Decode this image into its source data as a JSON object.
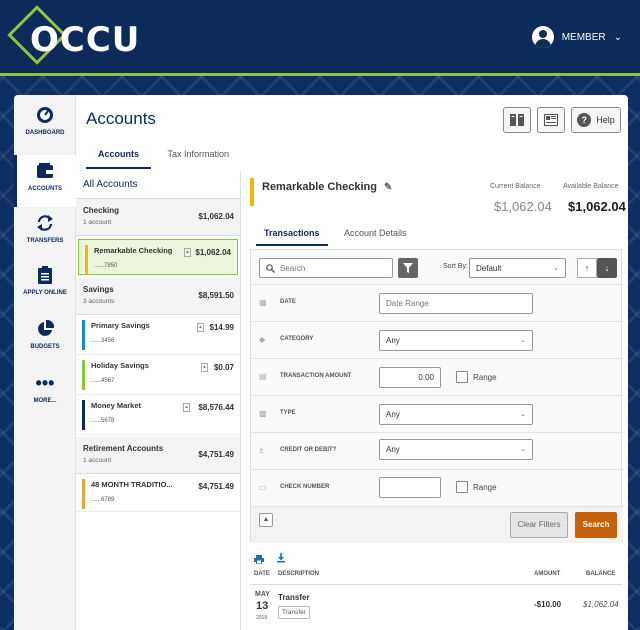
{
  "brand": {
    "logo_text": "OCCU",
    "accent": "#8cc63f",
    "navy": "#0c2a5a"
  },
  "header": {
    "member_label": "MEMBER"
  },
  "sidenav": [
    {
      "label": "DASHBOARD",
      "icon": "dashboard-icon"
    },
    {
      "label": "ACCOUNTS",
      "icon": "wallet-icon"
    },
    {
      "label": "TRANSFERS",
      "icon": "transfer-arrows-icon"
    },
    {
      "label": "APPLY ONLINE",
      "icon": "clipboard-icon"
    },
    {
      "label": "BUDGETS",
      "icon": "pie-chart-icon"
    },
    {
      "label": "MORE...",
      "icon": "more-icon"
    }
  ],
  "page": {
    "title": "Accounts",
    "help_label": "Help",
    "tabs": [
      "Accounts",
      "Tax Information"
    ]
  },
  "accounts": {
    "all_label": "All Accounts",
    "groups": [
      {
        "name": "Checking",
        "count": "1 account",
        "total": "$1,062.04",
        "items": [
          {
            "name": "Remarkable Checking",
            "number": "......7850",
            "amount": "$1,062.04",
            "color": "#f5b800"
          }
        ]
      },
      {
        "name": "Savings",
        "count": "3 accounts",
        "total": "$8,591.50",
        "items": [
          {
            "name": "Primary Savings",
            "number": "......3456",
            "amount": "$14.99",
            "color": "#1e88c8"
          },
          {
            "name": "Holiday Savings",
            "number": "......4567",
            "amount": "$0.07",
            "color": "#8cc63f"
          },
          {
            "name": "Money Market",
            "number": "......5678",
            "amount": "$8,576.44",
            "color": "#0c2a5a"
          }
        ]
      },
      {
        "name": "Retirement Accounts",
        "count": "1 account",
        "total": "$4,751.49",
        "items": [
          {
            "name": "48 MONTH TRADITIO...",
            "number": "......6789",
            "amount": "$4,751.49",
            "color": "#e8a33c"
          }
        ]
      }
    ]
  },
  "detail": {
    "title": "Remarkable Checking",
    "current_balance_label": "Current Balance",
    "current_balance": "$1,062.04",
    "available_balance_label": "Available Balance",
    "available_balance": "$1,062.04",
    "tabs": [
      "Transactions",
      "Account Details"
    ]
  },
  "filters": {
    "search_placeholder": "Search",
    "sort_by_label": "Sort By:",
    "sort_value": "Default",
    "rows": {
      "date_label": "DATE",
      "date_placeholder": "Date Range",
      "category_label": "CATEGORY",
      "category_value": "Any",
      "amount_label": "TRANSACTION AMOUNT",
      "amount_value": "0.00",
      "range_label": "Range",
      "type_label": "TYPE",
      "type_value": "Any",
      "credit_label": "CREDIT OR DEBIT?",
      "credit_value": "Any",
      "check_label": "CHECK NUMBER"
    },
    "clear_label": "Clear Filters",
    "search_label": "Search"
  },
  "transactions": {
    "headers": {
      "date": "DATE",
      "description": "DESCRIPTION",
      "amount": "AMOUNT",
      "balance": "BALANCE"
    },
    "rows": [
      {
        "month": "MAY",
        "day": "13",
        "year": "2019",
        "description": "Transfer",
        "tag": "Transfer",
        "amount": "-$10.00",
        "balance": "$1,062.04"
      }
    ]
  }
}
